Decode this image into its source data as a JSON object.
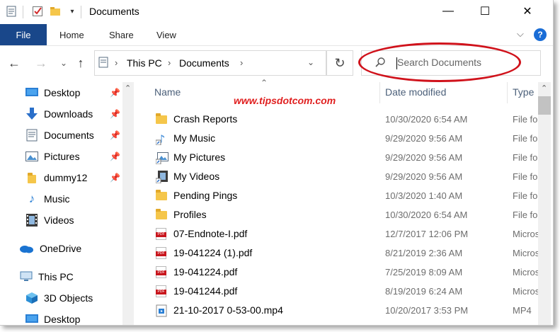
{
  "window": {
    "title": "Documents",
    "controls": [
      "—",
      "☐",
      "✕"
    ]
  },
  "ribbon": {
    "tabs": [
      "File",
      "Home",
      "Share",
      "View"
    ],
    "help": "?"
  },
  "address": {
    "crumbs": [
      "This PC",
      "Documents"
    ]
  },
  "search": {
    "placeholder": "Search Documents",
    "highlight_color": "#d0121b"
  },
  "watermark": "www.tipsdotcom.com",
  "navpane": {
    "items": [
      {
        "label": "Desktop",
        "icon": "desktop-icon",
        "pinned": true
      },
      {
        "label": "Downloads",
        "icon": "downloads-icon",
        "pinned": true
      },
      {
        "label": "Documents",
        "icon": "documents-icon",
        "pinned": true
      },
      {
        "label": "Pictures",
        "icon": "pictures-icon",
        "pinned": true
      },
      {
        "label": "dummy12",
        "icon": "folder-icon",
        "pinned": true
      },
      {
        "label": "Music",
        "icon": "music-icon",
        "pinned": false
      },
      {
        "label": "Videos",
        "icon": "videos-icon",
        "pinned": false
      },
      {
        "label": "OneDrive",
        "icon": "onedrive-icon",
        "pinned": false
      },
      {
        "label": "This PC",
        "icon": "this-pc-icon",
        "pinned": false
      },
      {
        "label": "3D Objects",
        "icon": "3d-objects-icon",
        "pinned": false
      },
      {
        "label": "Desktop",
        "icon": "desktop-icon",
        "pinned": false
      }
    ]
  },
  "filelist": {
    "columns": [
      "Name",
      "Date modified",
      "Type"
    ],
    "rows": [
      {
        "name": "Crash Reports",
        "date": "10/30/2020 6:54 AM",
        "type": "File folder",
        "icon": "folder-icon"
      },
      {
        "name": "My Music",
        "date": "9/29/2020 9:56 AM",
        "type": "File folder",
        "icon": "music-shortcut-icon"
      },
      {
        "name": "My Pictures",
        "date": "9/29/2020 9:56 AM",
        "type": "File folder",
        "icon": "pictures-shortcut-icon"
      },
      {
        "name": "My Videos",
        "date": "9/29/2020 9:56 AM",
        "type": "File folder",
        "icon": "videos-shortcut-icon"
      },
      {
        "name": "Pending Pings",
        "date": "10/3/2020 1:40 AM",
        "type": "File folder",
        "icon": "folder-icon"
      },
      {
        "name": "Profiles",
        "date": "10/30/2020 6:54 AM",
        "type": "File folder",
        "icon": "folder-icon"
      },
      {
        "name": "07-Endnote-I.pdf",
        "date": "12/7/2017 12:06 PM",
        "type": "Microsoft",
        "icon": "pdf-icon"
      },
      {
        "name": "19-041224 (1).pdf",
        "date": "8/21/2019 2:36 AM",
        "type": "Microsoft",
        "icon": "pdf-icon"
      },
      {
        "name": "19-041224.pdf",
        "date": "7/25/2019 8:09 AM",
        "type": "Microsoft",
        "icon": "pdf-icon"
      },
      {
        "name": "19-041244.pdf",
        "date": "8/19/2019 6:24 AM",
        "type": "Microsoft",
        "icon": "pdf-icon"
      },
      {
        "name": "21-10-2017 0-53-00.mp4",
        "date": "10/20/2017 3:53 PM",
        "type": "MP4",
        "icon": "video-file-icon"
      }
    ]
  }
}
